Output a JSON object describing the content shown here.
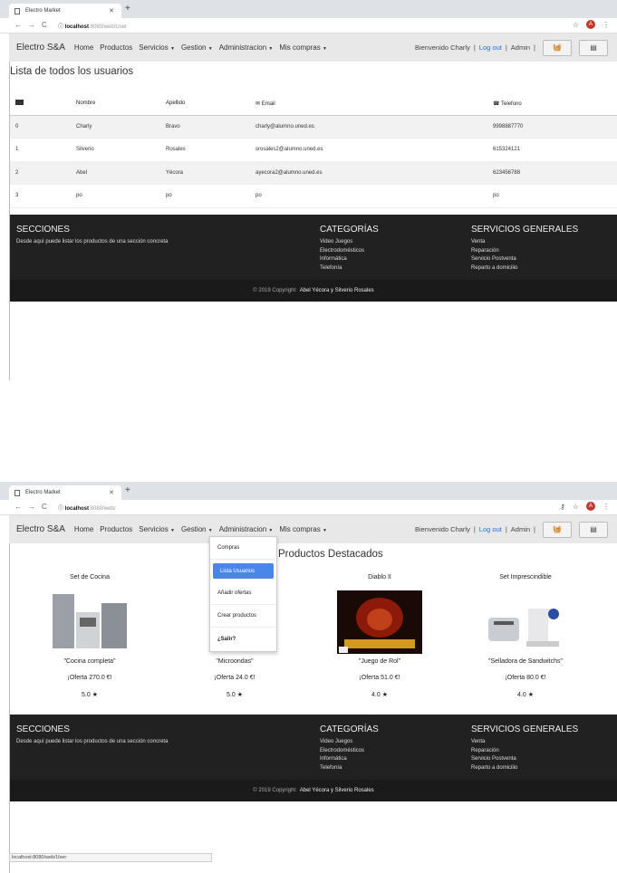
{
  "shot1": {
    "tab_title": "Electro Market",
    "url_host": "localhost",
    "url_path": ":8080/web/User",
    "brand": "Electro S&A",
    "nav": [
      "Home",
      "Productos",
      "Servicios",
      "Gestion",
      "Administracion",
      "Mis compras"
    ],
    "welcome": "Bienvenido Charly",
    "logout": "Log out",
    "role": "Admin",
    "page_title": "Lista de todos los usuarios",
    "columns": {
      "id": "",
      "nombre": "Nombre",
      "apellido": "Apellido",
      "email": "Email",
      "telefono": "Telefono"
    },
    "rows": [
      {
        "id": "0",
        "nombre": "Charly",
        "apellido": "Bravo",
        "email": "charly@alumno.uned.es",
        "telefono": "9998887770"
      },
      {
        "id": "1",
        "nombre": "Silverio",
        "apellido": "Rosales",
        "email": "srosales2@alumno.uned.es",
        "telefono": "615324121"
      },
      {
        "id": "2",
        "nombre": "Abel",
        "apellido": "Yécora",
        "email": "ayecora2@alumno.uned.es",
        "telefono": "623456788"
      },
      {
        "id": "3",
        "nombre": "po",
        "apellido": "po",
        "email": "po",
        "telefono": "po"
      }
    ]
  },
  "shot2": {
    "tab_title": "Electro Market",
    "url_host": "localhost",
    "url_path": ":8080/web/",
    "page_title": "s Productos Destacados",
    "dropdown": [
      "Compras",
      "Lista Usuarios",
      "Añadir ofertas",
      "Crear productos",
      "¿Salir?"
    ],
    "products": [
      {
        "name": "Set de Cocina",
        "desc": "\"Cocina completa\"",
        "offer": "¡Oferta 270.0 €!",
        "rating": "5.0 ★"
      },
      {
        "name": "",
        "desc": "\"Microondas\"",
        "offer": "¡Oferta 24.0 €!",
        "rating": "5.0 ★"
      },
      {
        "name": "Diablo II",
        "desc": "\"Juego de Rol\"",
        "offer": "¡Oferta 51.0 €!",
        "rating": "4.0 ★"
      },
      {
        "name": "Set Imprescindible",
        "desc": "\"Selladora de Sandwitchs\"",
        "offer": "¡Oferta 80.0 €!",
        "rating": "4.0 ★"
      }
    ],
    "status_url": "localhost:8080/web/User"
  },
  "footer": {
    "sections_title": "SECCIONES",
    "sections_text": "Desde aquí puede listar los productos de una sección concreta",
    "categories_title": "CATEGORÍAS",
    "categories": [
      "Video Juegos",
      "Electrodomésticos",
      "Informática",
      "Telefonía"
    ],
    "services_title": "SERVICIOS GENERALES",
    "services": [
      "Venta",
      "Reparación",
      "Servicio Postventa",
      "Reparto a domicilio"
    ],
    "copyright": "© 2019 Copyright:",
    "authors": "Abel Yécora y Silverio Rosales"
  }
}
